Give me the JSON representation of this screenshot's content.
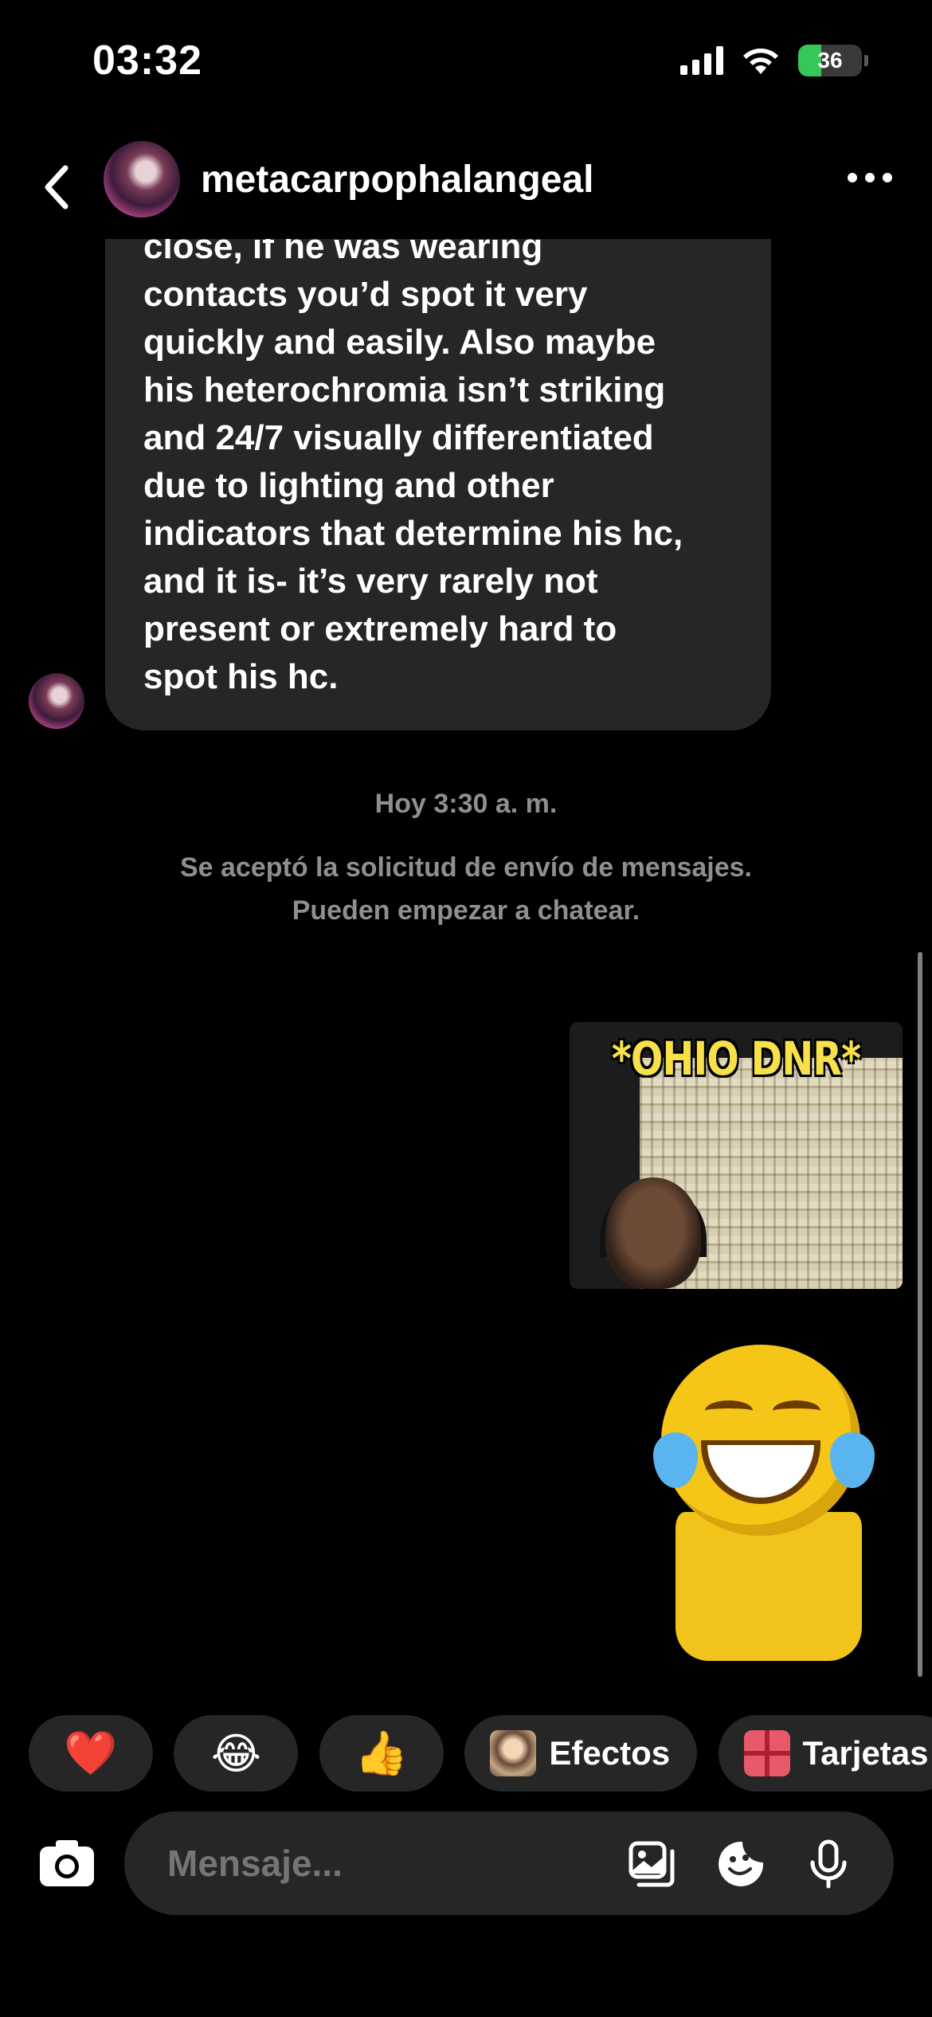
{
  "status_bar": {
    "time": "03:32",
    "battery_level": "36",
    "battery_fraction": 0.36,
    "battery_color": "#35c759",
    "icons": [
      "signal-icon",
      "wifi-icon",
      "battery-charging-icon"
    ]
  },
  "header": {
    "username": "metacarpophalangeal",
    "icons": [
      "back-chevron-icon",
      "more-options-icon"
    ]
  },
  "messages": {
    "incoming_lines": [
      "close, if he was wearing",
      "contacts you’d spot it very",
      "quickly and easily. Also maybe",
      "his heterochromia isn’t striking",
      "and 24/7 visually differentiated",
      "due to lighting and other",
      "indicators that determine his hc,",
      "and it is- it’s very rarely not",
      "present or extremely hard to",
      "spot his hc."
    ],
    "system_time": "Hoy 3:30 a. m.",
    "system_note_line1": "Se aceptó la solicitud de envío de mensajes.",
    "system_note_line2": "Pueden empezar a chatear.",
    "sticker_ohio_text": "*OHIO DNR*"
  },
  "quick_actions": {
    "reactions": [
      "❤️",
      "😂",
      "👍"
    ],
    "efectos_label": "Efectos",
    "tarjetas_label": "Tarjetas"
  },
  "composer": {
    "placeholder": "Mensaje...",
    "icons": [
      "camera-icon",
      "gallery-icon",
      "sticker-icon",
      "microphone-icon"
    ]
  }
}
